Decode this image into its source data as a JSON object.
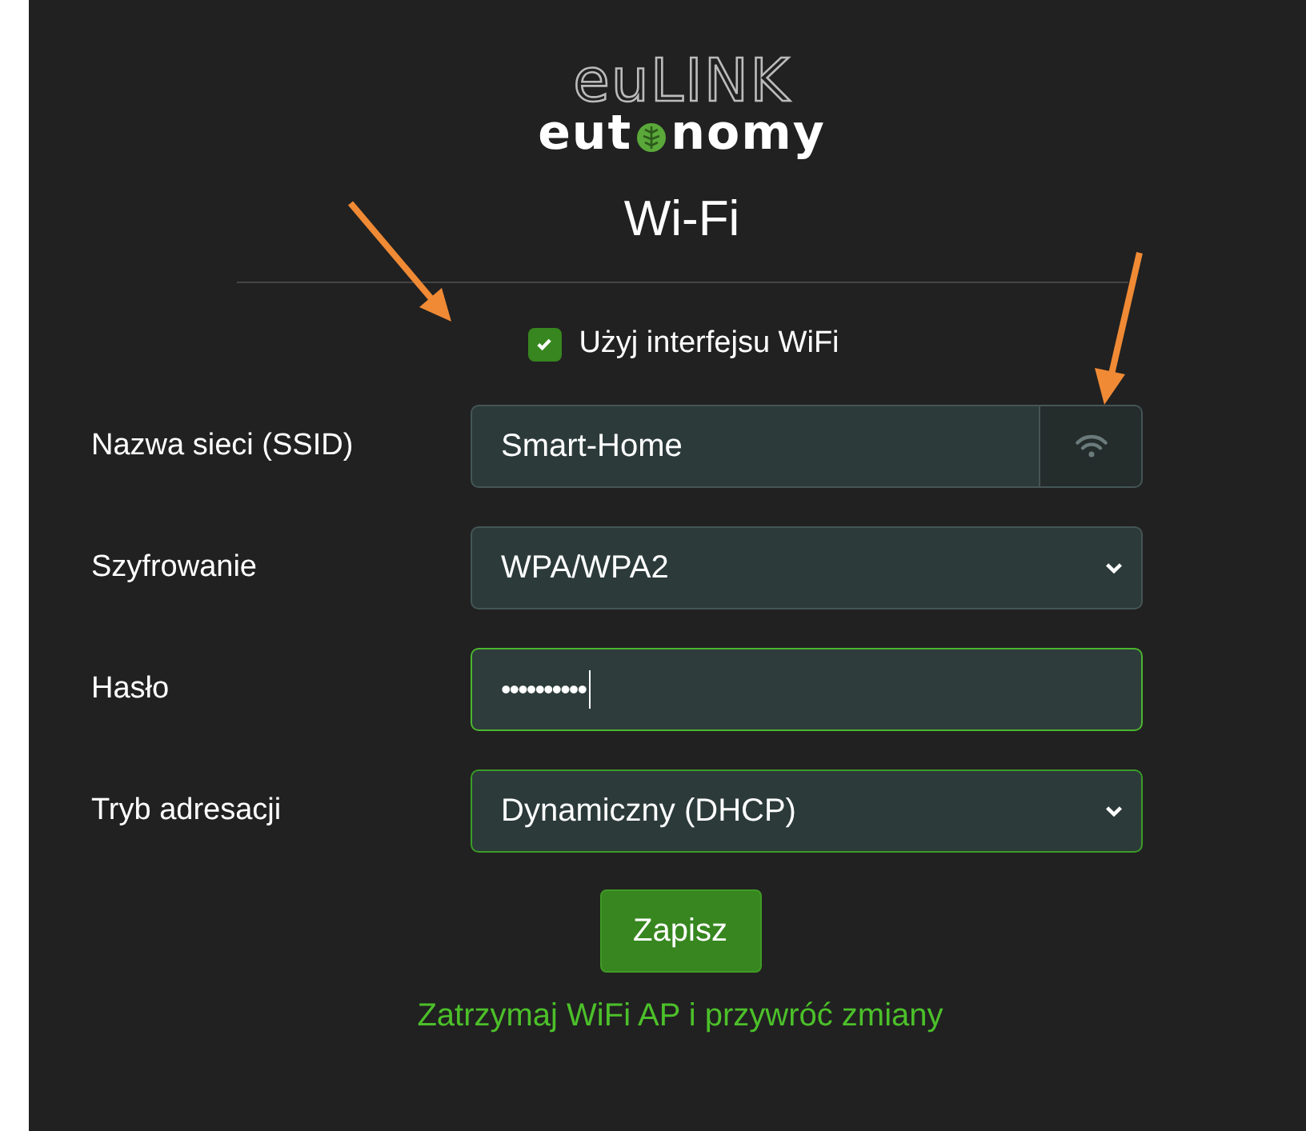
{
  "logo": {
    "product": "euLINK",
    "brand_start": "eut",
    "brand_end": "nomy"
  },
  "title": "Wi-Fi",
  "enable": {
    "label": "Użyj interfejsu WiFi",
    "checked": true
  },
  "fields": [
    {
      "kind": "text",
      "label": "Nazwa sieci (SSID)",
      "value": "Smart-Home",
      "valid": false,
      "focused": false,
      "scan_button": true
    },
    {
      "kind": "select",
      "label": "Szyfrowanie",
      "value": "WPA/WPA2",
      "valid": false,
      "focused": false,
      "scan_button": false
    },
    {
      "kind": "password",
      "label": "Hasło",
      "value": "••••••••••",
      "valid": true,
      "focused": true,
      "scan_button": false
    },
    {
      "kind": "select",
      "label": "Tryb adresacji",
      "value": "Dynamiczny (DHCP)",
      "valid": true,
      "focused": false,
      "scan_button": false
    }
  ],
  "save_button": "Zapisz",
  "stop_link": "Zatrzymaj WiFi AP i przywróć zmiany"
}
